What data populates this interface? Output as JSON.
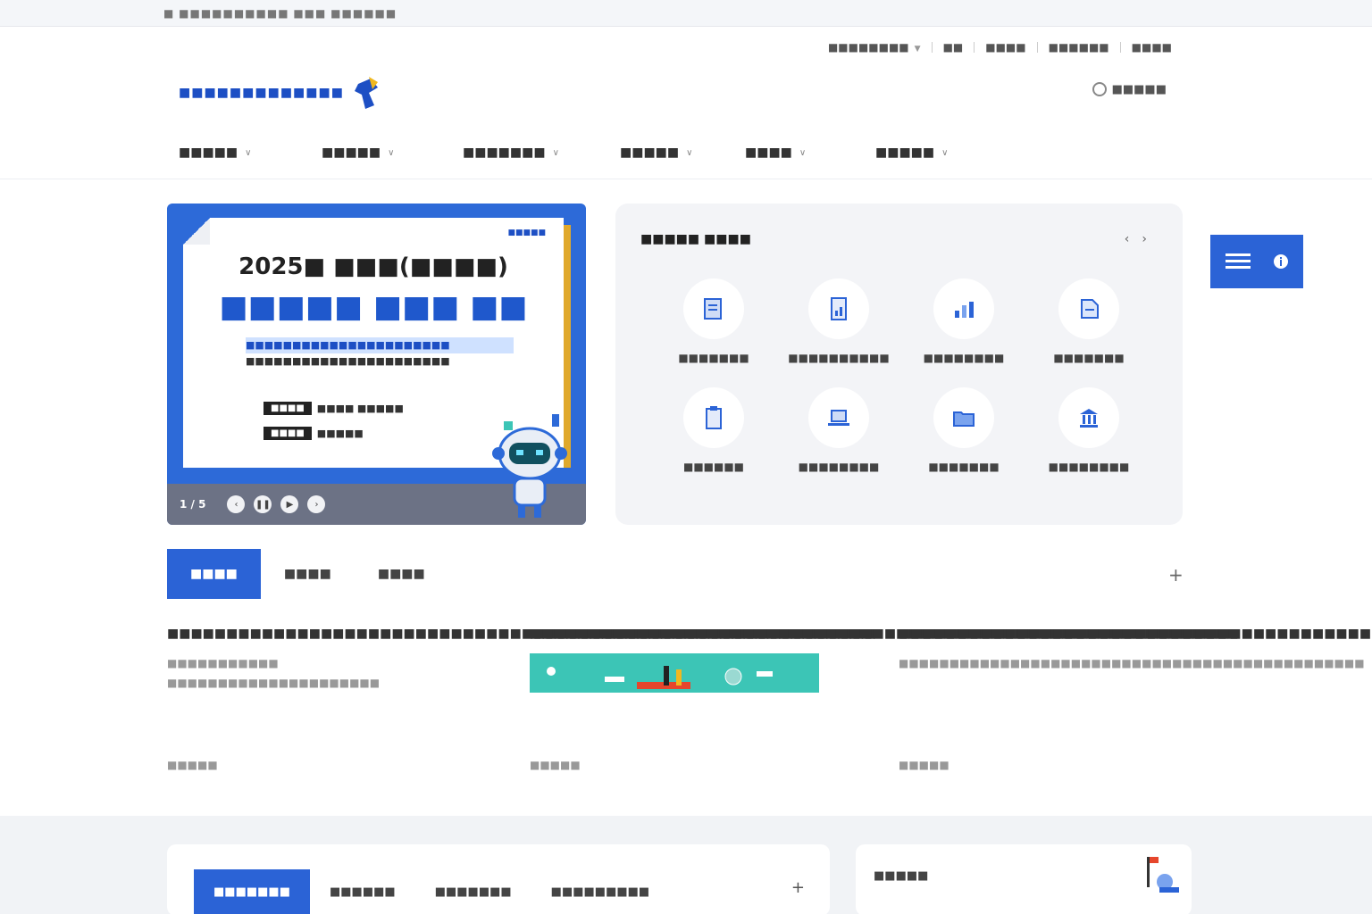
{
  "top_notice": "■ ■■■■■■■■■■ ■■■ ■■■■■■",
  "utility_links": [
    {
      "label": "■■■■■■■■",
      "dropdown": true
    },
    {
      "label": "■■",
      "dropdown": false
    },
    {
      "label": "■■■■",
      "dropdown": false
    },
    {
      "label": "■■■■■■",
      "dropdown": false
    },
    {
      "label": "■■■■",
      "dropdown": false
    }
  ],
  "logo_text": "■■■■■■■■■■■■■",
  "login_label": "■■■■■",
  "gnb": [
    {
      "label": "■■■■■"
    },
    {
      "label": "■■■■■"
    },
    {
      "label": "■■■■■■■"
    },
    {
      "label": "■■■■■"
    },
    {
      "label": "■■■■"
    },
    {
      "label": "■■■■■"
    }
  ],
  "banner": {
    "tag": "■■■■■",
    "headline": "2025■ ■■■(■■■■)",
    "subheadline": "■■■■■ ■■■ ■■",
    "desc_line1": "■■■■■■■■■■■■■■■■■■■■■■",
    "desc_line2": "■■■■■■■■■■■■■■■■■■■■■■",
    "row1_label": "■■■■",
    "row1_value": "■■■■ ■■■■■",
    "row2_label": "■■■■",
    "row2_value": "■■■■■",
    "pager": "1 / 5"
  },
  "quick_services": {
    "title": "■■■■■ ■■■■",
    "items": [
      {
        "label": "■■■■■■■",
        "icon": "document-icon"
      },
      {
        "label": "■■■■■■■■■■",
        "icon": "report-icon"
      },
      {
        "label": "■■■■■■■■",
        "icon": "chart-icon"
      },
      {
        "label": "■■■■■■■",
        "icon": "file-icon"
      },
      {
        "label": "■■■■■■",
        "icon": "clipboard-icon"
      },
      {
        "label": "■■■■■■■■",
        "icon": "laptop-icon"
      },
      {
        "label": "■■■■■■■",
        "icon": "folder-icon"
      },
      {
        "label": "■■■■■■■■",
        "icon": "building-icon"
      }
    ]
  },
  "tabs": [
    {
      "label": "■■■■",
      "active": true
    },
    {
      "label": "■■■■",
      "active": false
    },
    {
      "label": "■■■■",
      "active": false
    }
  ],
  "news": [
    {
      "title": "■■■■■■■■■■■■■■■■■■■■■■■■■■■■■■■■■■■■■■■■■■■■■■■■■■■■■■■■■■■■",
      "desc": "■■■■■■■■■■■ ■■■■■■■■■■■■■■■■■■■■■",
      "date": "■■■■■",
      "has_image": false
    },
    {
      "title": "■■■■■■■■■■■■■■■■■■■■■■■■■■■■■■■■■■■■■■■■■■■■■■■■■■■■■■■■■■■■",
      "desc": "",
      "date": "■■■■■",
      "has_image": true
    },
    {
      "title": "■■■■■■■■■■■■■■■■■■■■■■■■■■■■■■■■■■■■■■■■■",
      "desc": "■■■■■■■■■■■■■■■■■■■■■■■■■■■■■■■■■■■■■■■■■■■■■■",
      "date": "■■■■■",
      "has_image": false
    }
  ],
  "bottom_tabs": [
    {
      "label": "■■■■■■■",
      "active": true
    },
    {
      "label": "■■■■■■",
      "active": false
    },
    {
      "label": "■■■■■■■",
      "active": false
    },
    {
      "label": "■■■■■■■■■",
      "active": false
    }
  ],
  "bottom_right_title": "■■■■■",
  "colors": {
    "primary": "#2b63d6",
    "banner_bg": "#2d6ad8",
    "accent_gold": "#e0a92c",
    "teal": "#3cc5b6",
    "panel_bg": "#f3f4f7"
  }
}
